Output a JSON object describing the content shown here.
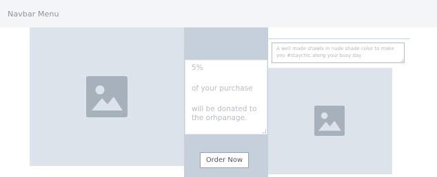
{
  "navbar": {
    "title": "Navbar Menu"
  },
  "hero_image": {
    "icon": "image-placeholder-icon"
  },
  "donation": {
    "percent": "5%",
    "line1": "of your purchase",
    "line2": "will be donated to",
    "line3": "the orhpanage."
  },
  "order_button": {
    "label": "Order Now"
  },
  "product_description": {
    "text": "A well made shawls in nude shade color to make you #staychic along your busy day"
  },
  "product_image": {
    "icon": "image-placeholder-icon"
  },
  "colors": {
    "placeholder_bg": "#dde3ea",
    "center_column_bg": "#c5d0da",
    "icon_fill": "#a6b1bc",
    "navbar_bg": "#f4f5f7"
  }
}
